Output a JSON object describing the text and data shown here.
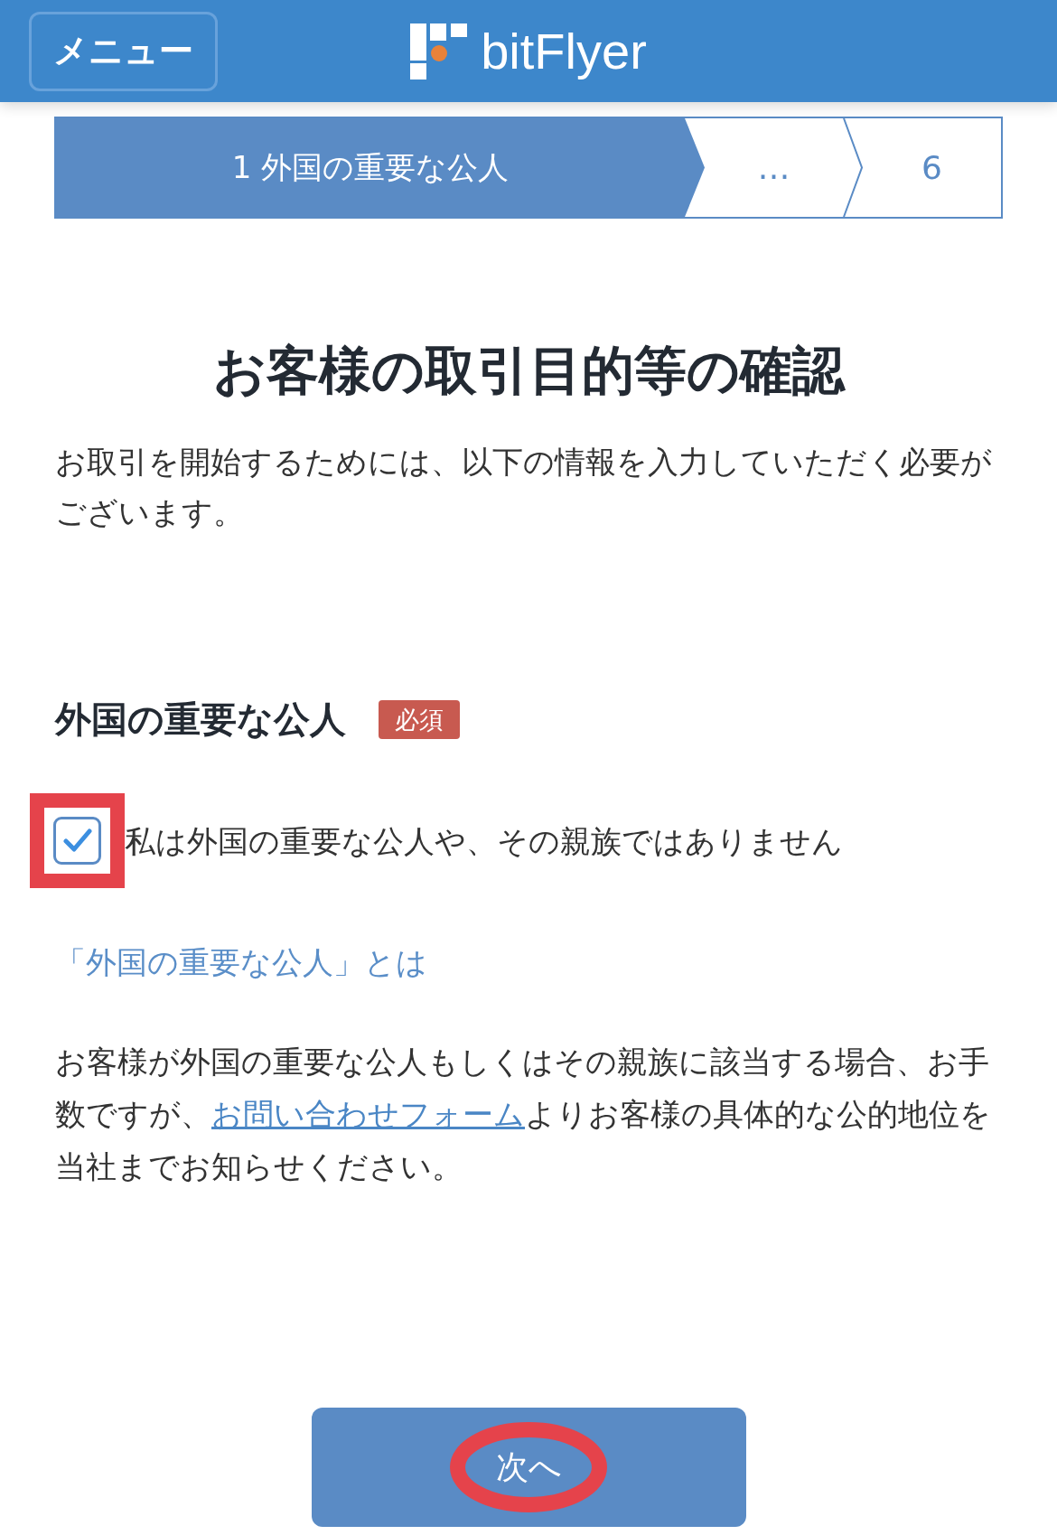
{
  "header": {
    "menu_button": "メニュー",
    "logo_text": "bitFlyer"
  },
  "steps": [
    {
      "label": "1 外国の重要な公人",
      "selected": true
    },
    {
      "label": "…",
      "selected": false
    },
    {
      "label": "6",
      "selected": false
    }
  ],
  "title": "お客様の取引目的等の確認",
  "intro": "お取引を開始するためには、以下の情報を入力していただく必要がございます。",
  "section": {
    "heading": "外国の重要な公人",
    "badge": "必須"
  },
  "agreement": {
    "label": "私は外国の重要な公人や、その親族ではありません",
    "checked": true,
    "highlighted": true
  },
  "info_link": "「外国の重要な公人」とは",
  "notice": {
    "before": "お客様が外国の重要な公人もしくはその親族に該当する場合、お手数ですが、",
    "link": "お問い合わせフォーム",
    "after": "よりお客様の具体的な公的地位を当社までお知らせください。"
  },
  "next_button": {
    "label": "次へ",
    "circled": true
  }
}
